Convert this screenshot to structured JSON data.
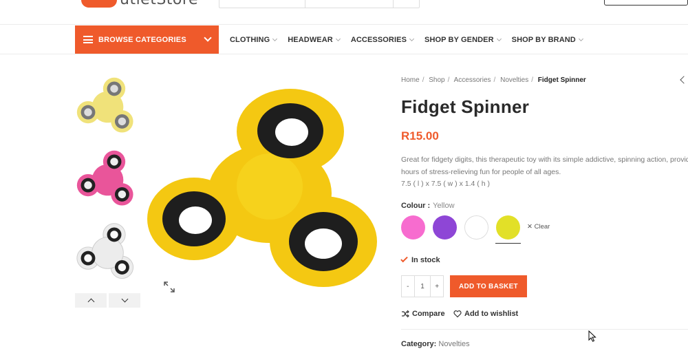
{
  "header": {
    "logo_text": "utletStore"
  },
  "nav": {
    "browse_label": "BROWSE CATEGORIES",
    "items": [
      {
        "label": "CLOTHING"
      },
      {
        "label": "HEADWEAR"
      },
      {
        "label": "ACCESSORIES"
      },
      {
        "label": "SHOP BY GENDER"
      },
      {
        "label": "SHOP BY BRAND"
      }
    ]
  },
  "gallery": {
    "thumbnails": [
      {
        "color": "#f0e27a"
      },
      {
        "color": "#e9559a"
      },
      {
        "color": "#ececec"
      }
    ],
    "main_color": "#f4c812"
  },
  "breadcrumb": [
    "Home",
    "Shop",
    "Accessories",
    "Novelties",
    "Fidget Spinner"
  ],
  "product": {
    "title": "Fidget Spinner",
    "price": "R15.00",
    "description_line1": "Great for fidgety digits, this therapeutic toy with its simple addictive, spinning action, provides",
    "description_line2": "hours of stress-relieving fun for people of all ages.",
    "dimensions": "7.5 ( l ) x 7.5 ( w ) x 1.4 ( h )",
    "colour_label": "Colour :",
    "colour_value": "Yellow",
    "swatches": [
      {
        "color": "#f76ccf"
      },
      {
        "color": "#8e46d6"
      },
      {
        "color": "#ffffff"
      },
      {
        "color": "#e2e028"
      }
    ],
    "clear_label": "Clear",
    "stock": "In stock",
    "quantity": "1",
    "minus": "-",
    "plus": "+",
    "add_to_basket": "ADD TO BASKET",
    "compare": "Compare",
    "wishlist": "Add to wishlist",
    "category_label": "Category:",
    "category_value": "Novelties"
  },
  "colors": {
    "accent": "#ef5a2b"
  }
}
